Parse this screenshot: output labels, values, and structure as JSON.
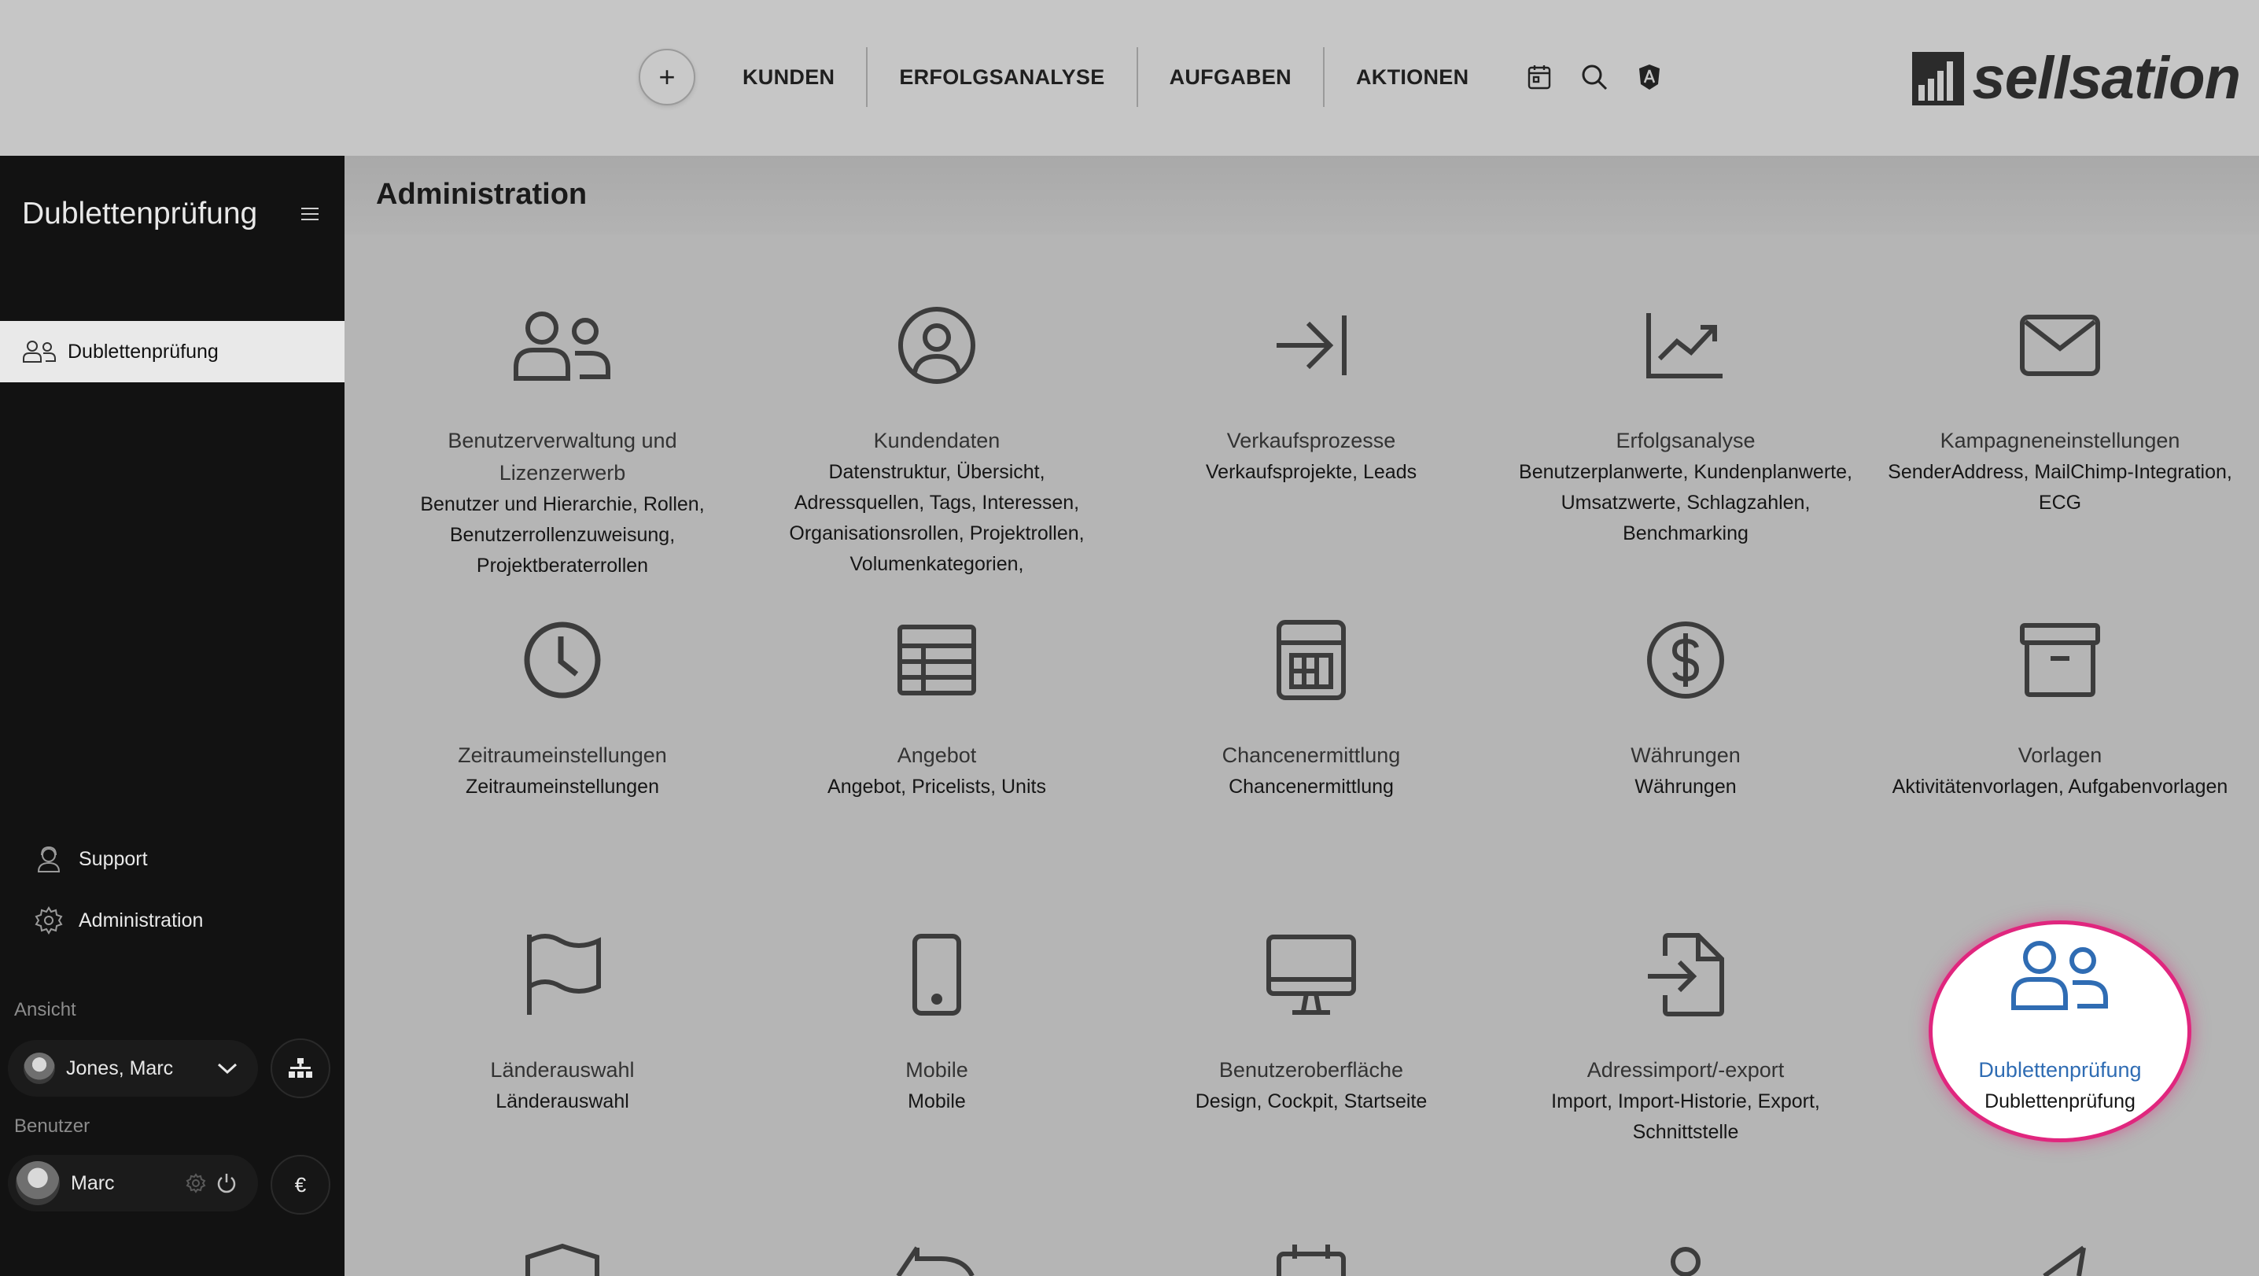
{
  "nav": {
    "add_label": "+",
    "items": [
      "KUNDEN",
      "ERFOLGSANALYSE",
      "AUFGABEN",
      "AKTIONEN"
    ]
  },
  "logo": {
    "text": "sellsation"
  },
  "sidebar": {
    "title": "Dublettenprüfung",
    "active_item": "Dublettenprüfung",
    "links": [
      "Support",
      "Administration"
    ],
    "view_section": "Ansicht",
    "view_user": "Jones, Marc",
    "user_section": "Benutzer",
    "user_name": "Marc",
    "currency_symbol": "€"
  },
  "page": {
    "title": "Administration"
  },
  "colors": {
    "highlight_ring": "#e0267e",
    "highlight_text": "#2f6cb3",
    "icon_default": "#3c3c3c"
  },
  "tiles": [
    {
      "icon": "users-icon",
      "title": "Benutzerverwaltung und Lizenzerwerb",
      "desc": "Benutzer und Hierarchie, Rollen, Benutzerrollenzuweisung, Projektberaterrollen"
    },
    {
      "icon": "user-circle-icon",
      "title": "Kundendaten",
      "desc": "Datenstruktur, Übersicht, Adressquellen, Tags, Interessen, Organisationsrollen, Projektrollen, Volumenkategorien,"
    },
    {
      "icon": "arrow-to-line-icon",
      "title": "Verkaufsprozesse",
      "desc": "Verkaufsprojekte, Leads"
    },
    {
      "icon": "chart-trend-icon",
      "title": "Erfolgsanalyse",
      "desc": "Benutzerplanwerte, Kundenplanwerte, Umsatzwerte, Schlagzahlen, Benchmarking"
    },
    {
      "icon": "envelope-icon",
      "title": "Kampagneneinstellungen",
      "desc": "SenderAddress, MailChimp-Integration, ECG"
    },
    {
      "icon": "clock-icon",
      "title": "Zeitraumeinstellungen",
      "desc": "Zeitraumeinstellungen"
    },
    {
      "icon": "table-icon",
      "title": "Angebot",
      "desc": "Angebot, Pricelists, Units"
    },
    {
      "icon": "calculator-icon",
      "title": "Chancenermittlung",
      "desc": "Chancenermittlung"
    },
    {
      "icon": "dollar-icon",
      "title": "Währungen",
      "desc": "Währungen"
    },
    {
      "icon": "archive-icon",
      "title": "Vorlagen",
      "desc": "Aktivitätenvorlagen, Aufgabenvorlagen"
    },
    {
      "icon": "flag-icon",
      "title": "Länderauswahl",
      "desc": "Länderauswahl"
    },
    {
      "icon": "mobile-icon",
      "title": "Mobile",
      "desc": "Mobile"
    },
    {
      "icon": "monitor-icon",
      "title": "Benutzeroberfläche",
      "desc": "Design, Cockpit, Startseite"
    },
    {
      "icon": "file-import-icon",
      "title": "Adressimport/-export",
      "desc": "Import, Import-Historie, Export, Schnittstelle"
    },
    {
      "icon": "users-icon",
      "title": "Dublettenprüfung",
      "desc": "Dublettenprüfung"
    }
  ]
}
